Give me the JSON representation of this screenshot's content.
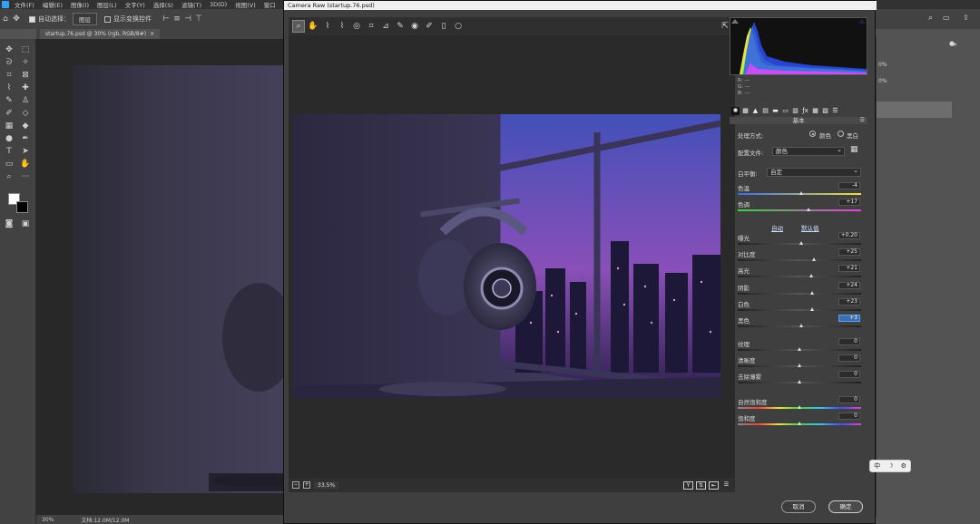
{
  "ps": {
    "menus": [
      "文件(F)",
      "编辑(E)",
      "图像(I)",
      "图层(L)",
      "文字(Y)",
      "选择(S)",
      "滤镜(T)",
      "3D(D)",
      "视图(V)",
      "窗口"
    ],
    "options": {
      "auto_select_label": "自动选择：",
      "auto_select_value": "图层",
      "transform_label": "显示变换控件"
    },
    "doc_tab": {
      "title": "startup.76.psd @ 30% (rgb, RGB/8#)",
      "close": "×"
    },
    "status": {
      "zoom": "30%",
      "doc_info": "文档:12.0M/12.0M"
    },
    "right_panel": {
      "pct1": "0%",
      "pct2": "0%"
    }
  },
  "acr": {
    "title": "Camera Raw (startup.76.psd)",
    "zoom_value": "33.5%",
    "histogram": {
      "r_label": "R:",
      "g_label": "G:",
      "b_label": "B:",
      "r": "---",
      "g": "---",
      "b": "---"
    },
    "panel_title": "基本",
    "treatment": {
      "label": "处理方式:",
      "color": "颜色",
      "bw": "黑白"
    },
    "profile": {
      "label": "配置文件:",
      "value": "颜色"
    },
    "wb": {
      "label": "白平衡:",
      "value": "自定"
    },
    "temp": {
      "label": "色温",
      "value": "-4",
      "pos": 0.52
    },
    "tint": {
      "label": "色调",
      "value": "+17",
      "pos": 0.58
    },
    "links": {
      "auto": "自动",
      "default": "默认值"
    },
    "tone": [
      {
        "label": "曝光",
        "value": "+0.20",
        "pos": 0.52
      },
      {
        "label": "对比度",
        "value": "+25",
        "pos": 0.62
      },
      {
        "label": "高光",
        "value": "+21",
        "pos": 0.6
      },
      {
        "label": "阴影",
        "value": "+24",
        "pos": 0.61
      },
      {
        "label": "白色",
        "value": "+23",
        "pos": 0.61
      },
      {
        "label": "黑色",
        "value": "+3",
        "pos": 0.52
      }
    ],
    "presence": [
      {
        "label": "纹理",
        "value": "0",
        "pos": 0.5
      },
      {
        "label": "清晰度",
        "value": "0",
        "pos": 0.5
      },
      {
        "label": "去除薄雾",
        "value": "0",
        "pos": 0.5
      }
    ],
    "saturation": [
      {
        "label": "自然饱和度",
        "value": "0",
        "pos": 0.5
      },
      {
        "label": "饱和度",
        "value": "0",
        "pos": 0.5
      }
    ],
    "buttons": {
      "cancel": "取消",
      "ok": "确定"
    }
  },
  "ime": {
    "lang": "中",
    "moon": "☽",
    "settings": "⚙"
  }
}
